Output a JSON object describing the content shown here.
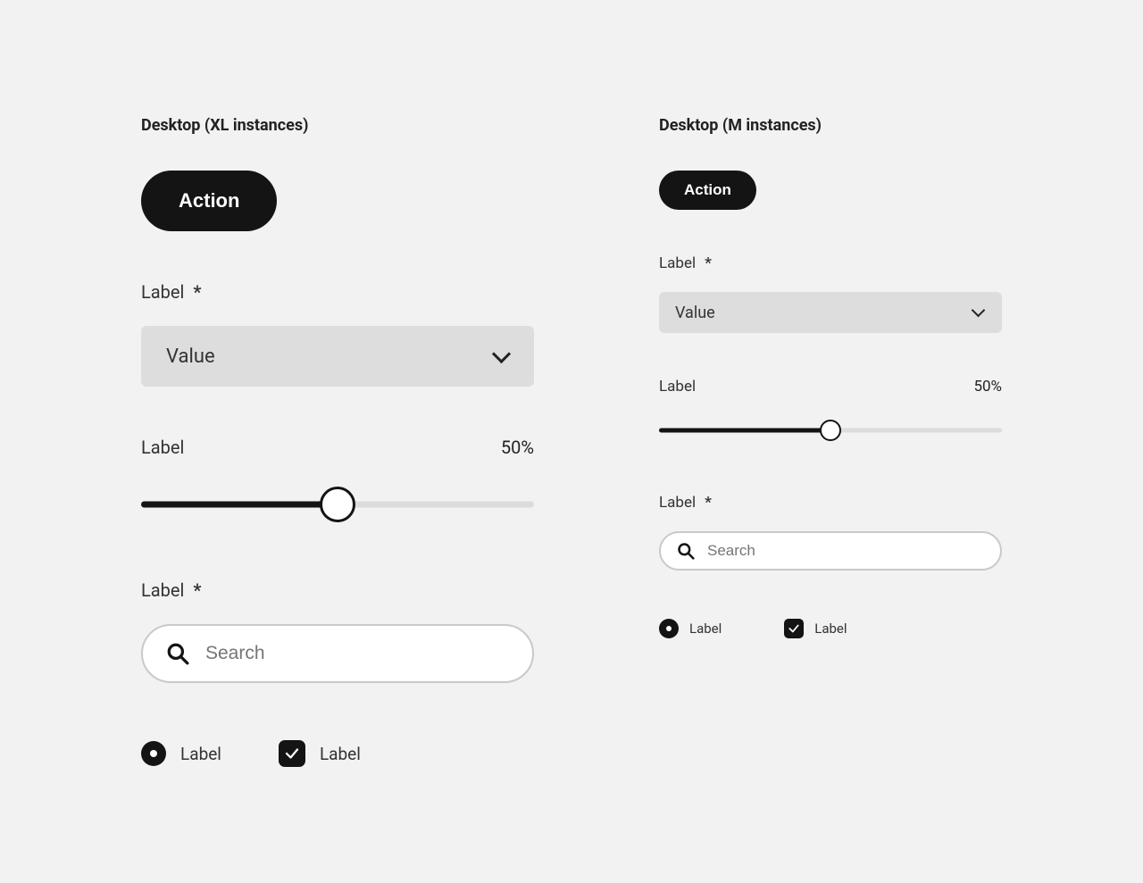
{
  "xl": {
    "title": "Desktop (XL instances)",
    "button_label": "Action",
    "select_field_label": "Label",
    "asterisk": "*",
    "select_value": "Value",
    "slider_label": "Label",
    "slider_value_text": "50%",
    "slider_percent": 50,
    "search_field_label": "Label",
    "search_placeholder": "Search",
    "radio_label": "Label",
    "checkbox_label": "Label"
  },
  "m": {
    "title": "Desktop (M instances)",
    "button_label": "Action",
    "select_field_label": "Label",
    "asterisk": "*",
    "select_value": "Value",
    "slider_label": "Label",
    "slider_value_text": "50%",
    "slider_percent": 50,
    "search_field_label": "Label",
    "search_placeholder": "Search",
    "radio_label": "Label",
    "checkbox_label": "Label"
  }
}
